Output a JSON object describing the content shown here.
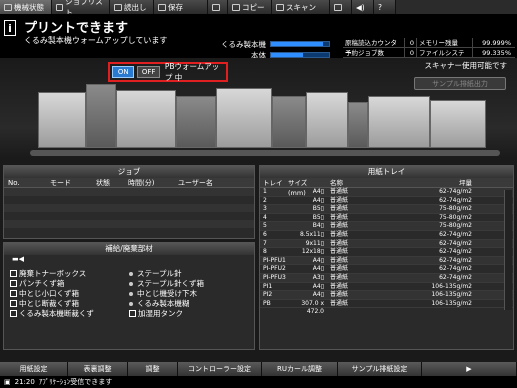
{
  "top_tabs": [
    "機械状態",
    "ジョブリスト",
    "読出し",
    "保存",
    "",
    "コピー",
    "スキャン",
    "",
    "",
    ""
  ],
  "header": {
    "title": "プリントできます",
    "subtitle": "くるみ製本機ウォームアップしています",
    "meters": [
      {
        "label": "くるみ製本機",
        "level": 0.9
      },
      {
        "label": "本体",
        "level": 0.55
      }
    ],
    "stats": [
      [
        "原稿読込カウンター",
        "0",
        "メモリー残量",
        "99.999%"
      ],
      [
        "予約ジョブ数",
        "0",
        "ファイルシステム残量",
        "99.335%"
      ]
    ],
    "scanner_note": "スキャナー使用可能です"
  },
  "warmup": {
    "on_label": "ON",
    "off_label": "OFF",
    "status": "PBウォームアップ 中"
  },
  "sample_button": "サンプル排紙出力",
  "job_panel": {
    "title": "ジョブ",
    "columns": [
      "No.",
      "モード",
      "状態",
      "時間(分)",
      "ユーザー名"
    ]
  },
  "tray_panel": {
    "title": "用紙トレイ",
    "columns": [
      "トレイ",
      "サイズ(mm)",
      "名称",
      "坪量"
    ],
    "rows": [
      [
        "1",
        "A4▯",
        "普通紙",
        "62-74g/m2"
      ],
      [
        "2",
        "A4▯",
        "普通紙",
        "62-74g/m2"
      ],
      [
        "3",
        "B5▯",
        "普通紙",
        "75-80g/m2"
      ],
      [
        "4",
        "B5▯",
        "普通紙",
        "75-80g/m2"
      ],
      [
        "5",
        "B4▯",
        "普通紙",
        "75-80g/m2"
      ],
      [
        "6",
        "8.5x11▯",
        "普通紙",
        "62-74g/m2"
      ],
      [
        "7",
        "9x11▯",
        "普通紙",
        "62-74g/m2"
      ],
      [
        "8",
        "12x18▯",
        "普通紙",
        "62-74g/m2"
      ],
      [
        "PI-PFU1",
        "A4▯",
        "普通紙",
        "62-74g/m2"
      ],
      [
        "PI-PFU2",
        "A4▯",
        "普通紙",
        "62-74g/m2"
      ],
      [
        "PI-PFU3",
        "A3▯",
        "普通紙",
        "62-74g/m2"
      ],
      [
        "PI1",
        "A4▯",
        "普通紙",
        "106-135g/m2"
      ],
      [
        "PI2",
        "A4▯",
        "普通紙",
        "106-135g/m2"
      ],
      [
        "PB",
        "307.0 x 472.0",
        "普通紙",
        "106-135g/m2"
      ]
    ]
  },
  "supplies_panel": {
    "title": "補給/廃棄部材",
    "left": [
      "廃棄トナーボックス",
      "パンチくず箱",
      "中とじ小口くず箱",
      "中とじ断裁くず箱",
      "くるみ製本機断裁くず"
    ],
    "right": [
      "ステープル針",
      "ステープル針くず箱",
      "中とじ機受け下木",
      "くるみ製本機糊",
      "加湿用タンク"
    ]
  },
  "bottom_tabs": [
    "用紙設定",
    "表裏調整",
    "調整",
    "コントローラー設定",
    "RUカール調整",
    "サンプル排紙設定",
    "▶"
  ],
  "status_bar": {
    "time": "21:20",
    "message": "ｱﾌﾟﾘｹｰｼｮﾝ受信できます"
  }
}
